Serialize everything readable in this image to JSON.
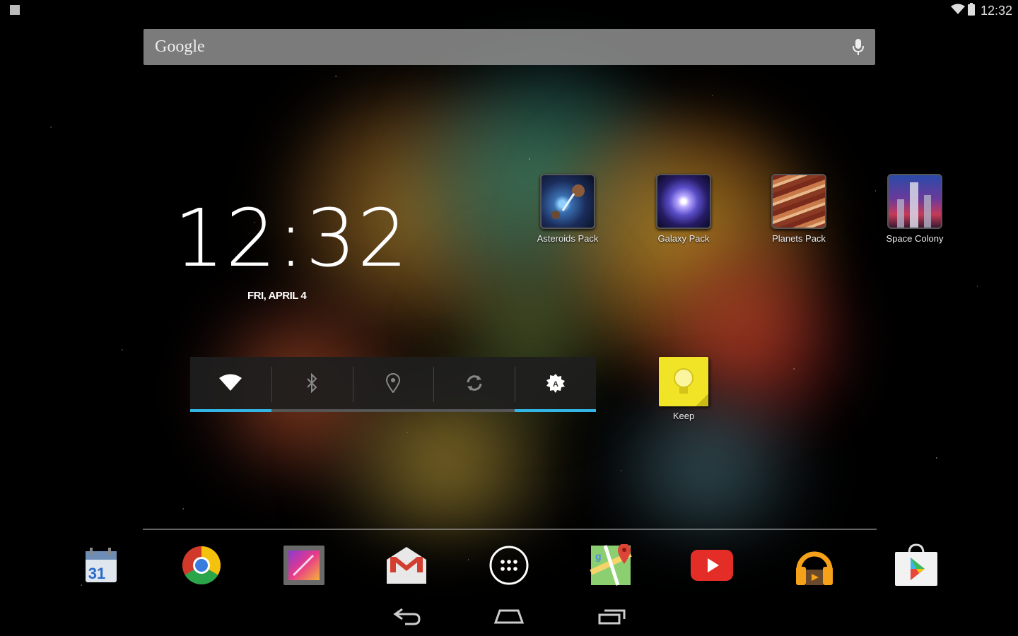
{
  "status_bar": {
    "time": "12:32",
    "icons": [
      "notification-icon",
      "wifi-icon",
      "battery-icon"
    ]
  },
  "search": {
    "label": "Google",
    "icon": "mic-icon"
  },
  "clock": {
    "time": "12:32",
    "date": "FRI, APRIL 4"
  },
  "apps": [
    {
      "label": "Asteroids Pack",
      "icon": "asteroids-pack-icon"
    },
    {
      "label": "Galaxy Pack",
      "icon": "galaxy-pack-icon"
    },
    {
      "label": "Planets Pack",
      "icon": "planets-pack-icon"
    },
    {
      "label": "Space Colony",
      "icon": "space-colony-icon"
    },
    {
      "label": "Keep",
      "icon": "keep-icon"
    }
  ],
  "power_widget": {
    "toggles": [
      {
        "name": "wifi",
        "icon": "wifi-icon",
        "on": true
      },
      {
        "name": "bluetooth",
        "icon": "bluetooth-icon",
        "on": false
      },
      {
        "name": "location",
        "icon": "location-icon",
        "on": false
      },
      {
        "name": "sync",
        "icon": "sync-icon",
        "on": false
      },
      {
        "name": "brightness",
        "icon": "brightness-auto-icon",
        "on": true
      }
    ]
  },
  "dock": {
    "icons": [
      "calendar-icon",
      "chrome-icon",
      "gallery-icon",
      "gmail-icon",
      "app-drawer-icon",
      "maps-icon",
      "youtube-icon",
      "play-music-icon",
      "play-store-icon"
    ],
    "calendar_day": "31"
  },
  "nav_bar": {
    "icons": [
      "back-icon",
      "home-icon",
      "recents-icon"
    ]
  },
  "colors": {
    "accent": "#33b5e5",
    "search_bar": "#969696",
    "keep_yellow": "#f1e426",
    "youtube_red": "#e52d27",
    "gmail_red": "#d23f31"
  }
}
